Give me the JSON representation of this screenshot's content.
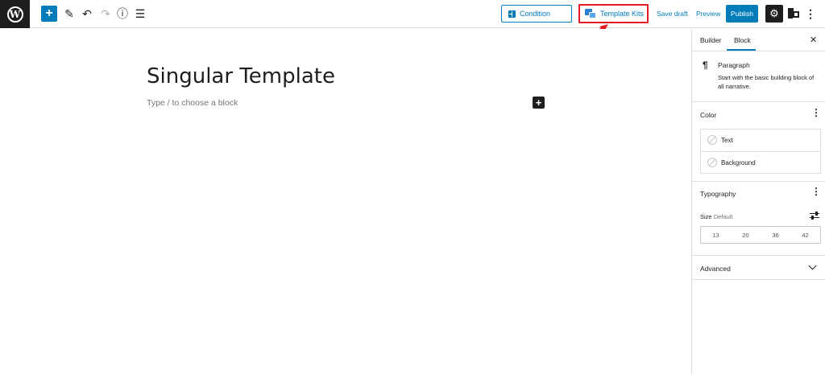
{
  "toolbar": {
    "add_icon": "plus-icon",
    "tools_icon": "pencil-icon",
    "undo_icon": "undo-icon",
    "redo_icon": "redo-icon",
    "info_icon": "info-icon",
    "list_icon": "list-view-icon",
    "condition_label": "Condition",
    "template_kits_label": "Template Kits",
    "save_draft_label": "Save draft",
    "preview_label": "Preview",
    "publish_label": "Publish",
    "accent_color": "#007cba",
    "highlight_color": "#e01b24"
  },
  "editor": {
    "title": "Singular Template",
    "placeholder": "Type / to choose a block"
  },
  "sidebar": {
    "tabs": [
      {
        "label": "Builder"
      },
      {
        "label": "Block"
      }
    ],
    "block": {
      "name": "Paragraph",
      "description": "Start with the basic building block of all narrative."
    },
    "color": {
      "title": "Color",
      "items": [
        {
          "label": "Text"
        },
        {
          "label": "Background"
        }
      ]
    },
    "typography": {
      "title": "Typography",
      "size_label": "Size",
      "size_value": "Default",
      "sizes": [
        "13",
        "20",
        "36",
        "42"
      ]
    },
    "advanced": {
      "title": "Advanced"
    }
  }
}
